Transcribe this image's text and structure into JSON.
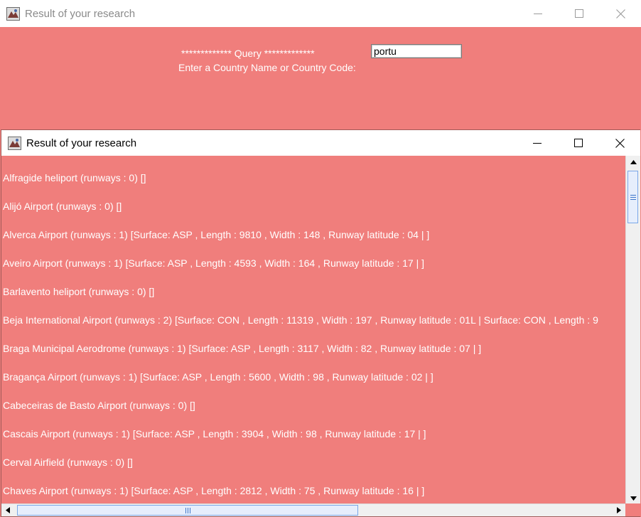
{
  "outer_window": {
    "title": "Result of your research",
    "query_heading": "************* Query *************",
    "query_prompt": "Enter a Country Name or Country Code:",
    "query_value": "portu"
  },
  "inner_window": {
    "title": "Result of your research",
    "results": [
      "Alfragide heliport (runways : 0)  []",
      "Alijó Airport (runways : 0)  []",
      "Alverca Airport (runways : 1)  [Surface: ASP , Length : 9810 , Width : 148 , Runway latitude : 04 | ]",
      "Aveiro Airport (runways : 1)  [Surface: ASP , Length : 4593 , Width : 164 , Runway latitude : 17 | ]",
      "Barlavento heliport (runways : 0)  []",
      "Beja International Airport (runways : 2)  [Surface: CON , Length : 11319 , Width : 197 , Runway latitude : 01L | Surface: CON , Length : 9",
      "Braga Municipal Aerodrome (runways : 1)  [Surface: ASP , Length : 3117 , Width : 82 , Runway latitude : 07 | ]",
      "Bragança Airport (runways : 1)  [Surface: ASP , Length : 5600 , Width : 98 , Runway latitude : 02 | ]",
      "Cabeceiras de Basto Airport (runways : 0)  []",
      "Cascais Airport (runways : 1)  [Surface: ASP , Length : 3904 , Width : 98 , Runway latitude : 17 | ]",
      "Cerval Airfield (runways : 0)  []",
      "Chaves Airport (runways : 1)  [Surface: ASP , Length : 2812 , Width : 75 , Runway latitude : 16 | ]"
    ]
  },
  "icons": {
    "app": "java-app-icon",
    "minimize": "minimize-icon",
    "maximize": "maximize-icon",
    "close": "close-icon"
  }
}
